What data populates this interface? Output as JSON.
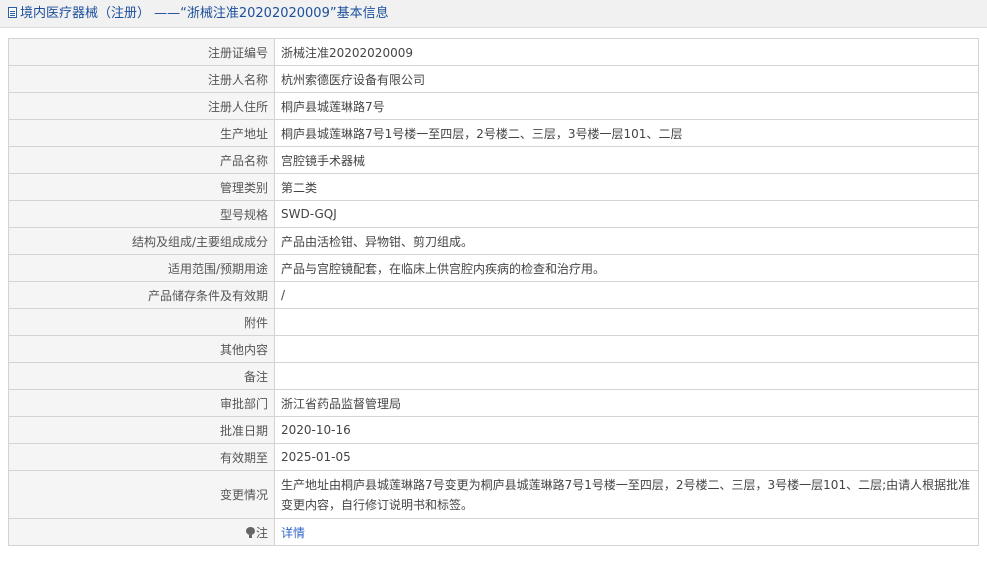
{
  "header": {
    "icon": "document-icon",
    "title": "境内医疗器械（注册） ——“浙械注准20202020009”基本信息"
  },
  "rows": [
    {
      "label": "注册证编号",
      "value": "浙械注准20202020009"
    },
    {
      "label": "注册人名称",
      "value": "杭州索德医疗设备有限公司"
    },
    {
      "label": "注册人住所",
      "value": "桐庐县城莲琳路7号"
    },
    {
      "label": "生产地址",
      "value": "桐庐县城莲琳路7号1号楼一至四层，2号楼二、三层，3号楼一层101、二层"
    },
    {
      "label": "产品名称",
      "value": "宫腔镜手术器械"
    },
    {
      "label": "管理类别",
      "value": "第二类"
    },
    {
      "label": "型号规格",
      "value": "SWD-GQJ"
    },
    {
      "label": "结构及组成/主要组成成分",
      "value": "产品由活检钳、异物钳、剪刀组成。"
    },
    {
      "label": "适用范围/预期用途",
      "value": "产品与宫腔镜配套，在临床上供宫腔内疾病的检查和治疗用。"
    },
    {
      "label": "产品储存条件及有效期",
      "value": "/"
    },
    {
      "label": "附件",
      "value": ""
    },
    {
      "label": "其他内容",
      "value": ""
    },
    {
      "label": "备注",
      "value": ""
    },
    {
      "label": "审批部门",
      "value": "浙江省药品监督管理局"
    },
    {
      "label": "批准日期",
      "value": "2020-10-16"
    },
    {
      "label": "有效期至",
      "value": "2025-01-05"
    },
    {
      "label": "变更情况",
      "value": "生产地址由桐庐县城莲琳路7号变更为桐庐县城莲琳路7号1号楼一至四层，2号楼二、三层，3号楼一层101、二层;由请人根据批准变更内容，自行修订说明书和标签。"
    }
  ],
  "note": {
    "icon": "lightbulb-icon",
    "label": "注",
    "link_text": "详情"
  }
}
